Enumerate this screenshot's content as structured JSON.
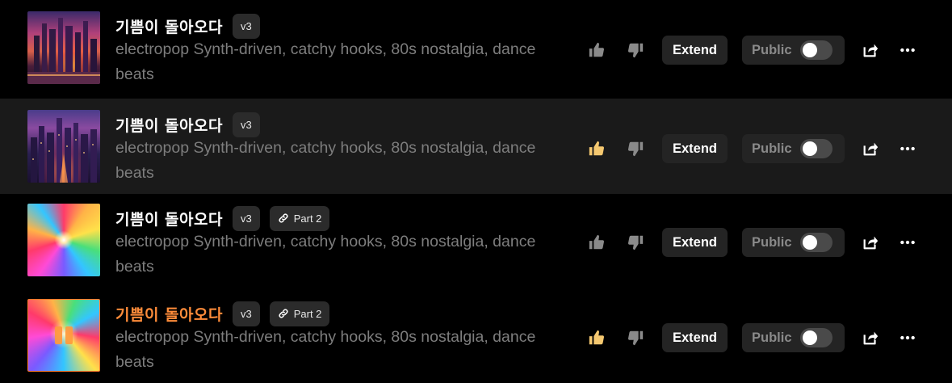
{
  "songs": [
    {
      "title": "기쁨이 돌아오다",
      "version": "v3",
      "part": "",
      "description": "electropop Synth-driven, catchy hooks, 80s nostalgia, dance beats",
      "extend_label": "Extend",
      "public_label": "Public",
      "liked": false,
      "selected": false,
      "playing": false,
      "thumb": "city1"
    },
    {
      "title": "기쁨이 돌아오다",
      "version": "v3",
      "part": "",
      "description": "electropop Synth-driven, catchy hooks, 80s nostalgia, dance beats",
      "extend_label": "Extend",
      "public_label": "Public",
      "liked": true,
      "selected": true,
      "playing": false,
      "thumb": "city2"
    },
    {
      "title": "기쁨이 돌아오다",
      "version": "v3",
      "part": "Part 2",
      "description": "electropop Synth-driven, catchy hooks, 80s nostalgia, dance beats",
      "extend_label": "Extend",
      "public_label": "Public",
      "liked": false,
      "selected": false,
      "playing": false,
      "thumb": "rays"
    },
    {
      "title": "기쁨이 돌아오다",
      "version": "v3",
      "part": "Part 2",
      "description": "electropop Synth-driven, catchy hooks, 80s nostalgia, dance beats",
      "extend_label": "Extend",
      "public_label": "Public",
      "liked": true,
      "selected": false,
      "playing": true,
      "thumb": "rays2"
    }
  ],
  "icons": {
    "like": "thumbs-up-icon",
    "dislike": "thumbs-down-icon",
    "share": "share-icon",
    "more": "more-icon",
    "link": "link-icon",
    "pause": "pause-icon"
  },
  "colors": {
    "background": "#000000",
    "selected_row": "#1a1a1a",
    "playing_title": "#ff8c3a",
    "liked_thumb": "#f5c870",
    "muted_text": "#7d7d7d"
  }
}
